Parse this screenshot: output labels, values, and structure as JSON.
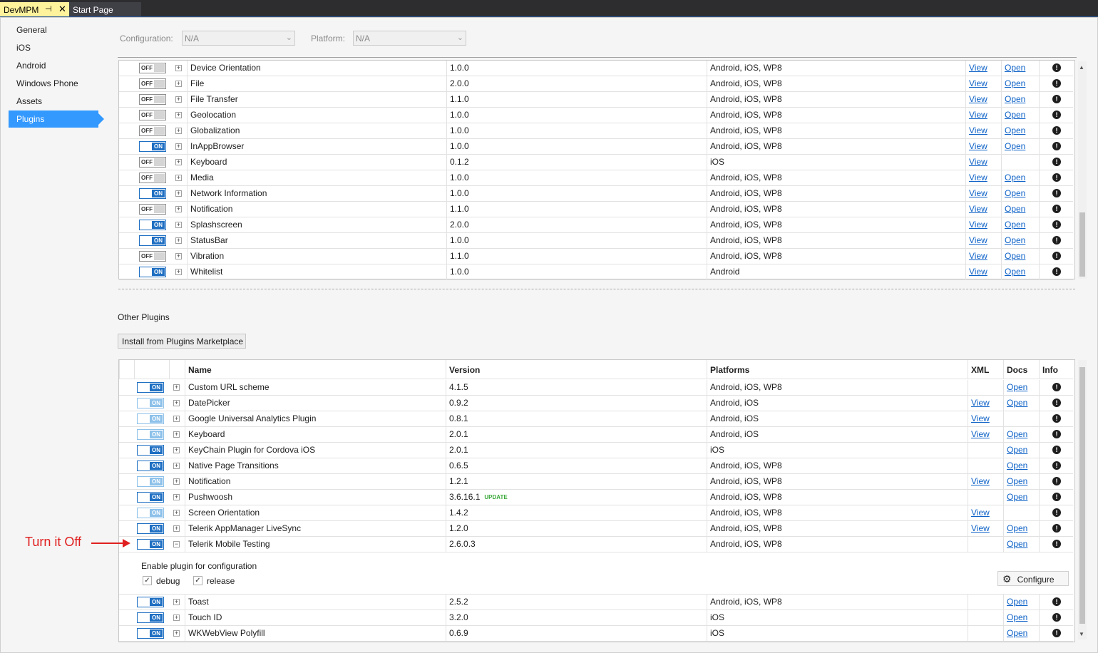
{
  "tabs": {
    "active": "DevMPM",
    "other": "Start Page"
  },
  "nav": [
    "General",
    "iOS",
    "Android",
    "Windows Phone",
    "Assets",
    "Plugins"
  ],
  "config": {
    "configuration_label": "Configuration:",
    "configuration_value": "N/A",
    "platform_label": "Platform:",
    "platform_value": "N/A"
  },
  "core_plugins": [
    {
      "state": "OFF",
      "name": "Device Orientation",
      "version": "1.0.0",
      "platforms": "Android, iOS, WP8",
      "xml": "View",
      "docs": "Open"
    },
    {
      "state": "OFF",
      "name": "File",
      "version": "2.0.0",
      "platforms": "Android, iOS, WP8",
      "xml": "View",
      "docs": "Open"
    },
    {
      "state": "OFF",
      "name": "File Transfer",
      "version": "1.1.0",
      "platforms": "Android, iOS, WP8",
      "xml": "View",
      "docs": "Open"
    },
    {
      "state": "OFF",
      "name": "Geolocation",
      "version": "1.0.0",
      "platforms": "Android, iOS, WP8",
      "xml": "View",
      "docs": "Open"
    },
    {
      "state": "OFF",
      "name": "Globalization",
      "version": "1.0.0",
      "platforms": "Android, iOS, WP8",
      "xml": "View",
      "docs": "Open"
    },
    {
      "state": "ON",
      "name": "InAppBrowser",
      "version": "1.0.0",
      "platforms": "Android, iOS, WP8",
      "xml": "View",
      "docs": "Open"
    },
    {
      "state": "OFF",
      "name": "Keyboard",
      "version": "0.1.2",
      "platforms": "iOS",
      "xml": "View",
      "docs": ""
    },
    {
      "state": "OFF",
      "name": "Media",
      "version": "1.0.0",
      "platforms": "Android, iOS, WP8",
      "xml": "View",
      "docs": "Open"
    },
    {
      "state": "ON",
      "name": "Network Information",
      "version": "1.0.0",
      "platforms": "Android, iOS, WP8",
      "xml": "View",
      "docs": "Open"
    },
    {
      "state": "OFF",
      "name": "Notification",
      "version": "1.1.0",
      "platforms": "Android, iOS, WP8",
      "xml": "View",
      "docs": "Open"
    },
    {
      "state": "ON",
      "name": "Splashscreen",
      "version": "2.0.0",
      "platforms": "Android, iOS, WP8",
      "xml": "View",
      "docs": "Open"
    },
    {
      "state": "ON",
      "name": "StatusBar",
      "version": "1.0.0",
      "platforms": "Android, iOS, WP8",
      "xml": "View",
      "docs": "Open"
    },
    {
      "state": "OFF",
      "name": "Vibration",
      "version": "1.1.0",
      "platforms": "Android, iOS, WP8",
      "xml": "View",
      "docs": "Open"
    },
    {
      "state": "ON",
      "name": "Whitelist",
      "version": "1.0.0",
      "platforms": "Android",
      "xml": "View",
      "docs": "Open"
    }
  ],
  "other_plugins_title": "Other Plugins",
  "install_button": "Install from Plugins Marketplace",
  "other_headers": {
    "name": "Name",
    "version": "Version",
    "platforms": "Platforms",
    "xml": "XML",
    "docs": "Docs",
    "info": "Info"
  },
  "other_plugins": [
    {
      "state": "ON",
      "dim": false,
      "name": "Custom URL scheme",
      "version": "4.1.5",
      "platforms": "Android, iOS, WP8",
      "xml": "",
      "docs": "Open"
    },
    {
      "state": "ON",
      "dim": true,
      "name": "DatePicker",
      "version": "0.9.2",
      "platforms": "Android, iOS",
      "xml": "View",
      "docs": "Open"
    },
    {
      "state": "ON",
      "dim": true,
      "name": "Google Universal Analytics Plugin",
      "version": "0.8.1",
      "platforms": "Android, iOS",
      "xml": "View",
      "docs": ""
    },
    {
      "state": "ON",
      "dim": true,
      "name": "Keyboard",
      "version": "2.0.1",
      "platforms": "Android, iOS",
      "xml": "View",
      "docs": "Open"
    },
    {
      "state": "ON",
      "dim": false,
      "name": "KeyChain Plugin for Cordova iOS",
      "version": "2.0.1",
      "platforms": "iOS",
      "xml": "",
      "docs": "Open"
    },
    {
      "state": "ON",
      "dim": false,
      "name": "Native Page Transitions",
      "version": "0.6.5",
      "platforms": "Android, iOS, WP8",
      "xml": "",
      "docs": "Open"
    },
    {
      "state": "ON",
      "dim": true,
      "name": "Notification",
      "version": "1.2.1",
      "platforms": "Android, iOS, WP8",
      "xml": "View",
      "docs": "Open"
    },
    {
      "state": "ON",
      "dim": false,
      "name": "Pushwoosh",
      "version": "3.6.16.1",
      "update": "UPDATE",
      "platforms": "Android, iOS, WP8",
      "xml": "",
      "docs": "Open"
    },
    {
      "state": "ON",
      "dim": true,
      "name": "Screen Orientation",
      "version": "1.4.2",
      "platforms": "Android, iOS, WP8",
      "xml": "View",
      "docs": ""
    },
    {
      "state": "ON",
      "dim": false,
      "name": "Telerik AppManager LiveSync",
      "version": "1.2.0",
      "platforms": "Android, iOS, WP8",
      "xml": "View",
      "docs": "Open"
    },
    {
      "state": "ON",
      "dim": false,
      "name": "Telerik Mobile Testing",
      "version": "2.6.0.3",
      "platforms": "Android, iOS, WP8",
      "xml": "",
      "docs": "Open",
      "expanded": true
    }
  ],
  "other_plugins_after": [
    {
      "state": "ON",
      "dim": false,
      "name": "Toast",
      "version": "2.5.2",
      "platforms": "Android, iOS, WP8",
      "xml": "",
      "docs": "Open"
    },
    {
      "state": "ON",
      "dim": false,
      "name": "Touch ID",
      "version": "3.2.0",
      "platforms": "iOS",
      "xml": "",
      "docs": "Open"
    },
    {
      "state": "ON",
      "dim": false,
      "name": "WKWebView Polyfill",
      "version": "0.6.9",
      "platforms": "iOS",
      "xml": "",
      "docs": "Open"
    }
  ],
  "expanded_panel": {
    "title": "Enable plugin for configuration",
    "debug_label": "debug",
    "release_label": "release",
    "configure_label": "Configure"
  },
  "annotation": "Turn it Off",
  "colors": {
    "accent": "#3399ff",
    "toggle_on": "#1f6fc2",
    "annotation": "#e02020",
    "link": "#0e62c7"
  }
}
